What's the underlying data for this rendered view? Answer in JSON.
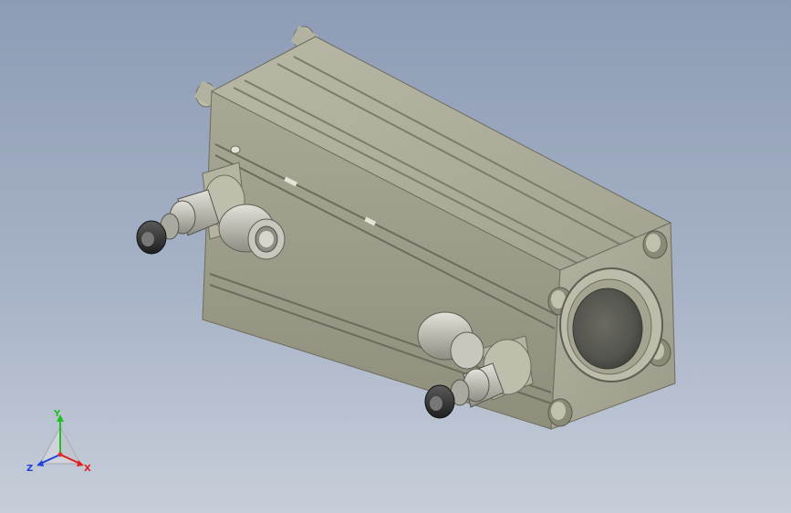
{
  "viewport": {
    "background_top": "#8d9cb5",
    "background_bottom": "#c7ced9"
  },
  "model": {
    "body_color": "#a5a491",
    "shadow_color": "#6e6d5d",
    "dark_part_color": "#2f2f2f",
    "metal_color": "#c9c9c2"
  },
  "triad": {
    "y_label": "Y",
    "x_label": "X",
    "z_label": "Z",
    "x_color": "#e02020",
    "y_color": "#20c020",
    "z_color": "#2040e0"
  }
}
